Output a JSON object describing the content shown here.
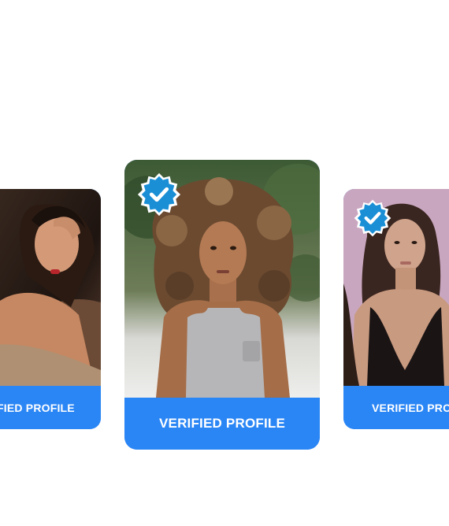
{
  "cards": [
    {
      "name": "left",
      "label": "VERIFIED PROFILE",
      "visible_label": "FIED PROFILE"
    },
    {
      "name": "center",
      "label": "VERIFIED PROFILE"
    },
    {
      "name": "right",
      "label": "VERIFIED PROFILE",
      "visible_label": "VERIFIED PRO"
    }
  ],
  "colors": {
    "accent": "#2b86f5",
    "badge": "#1a8fd6",
    "background": "#ffffff"
  },
  "icons": {
    "badge": "verified-check-icon"
  }
}
